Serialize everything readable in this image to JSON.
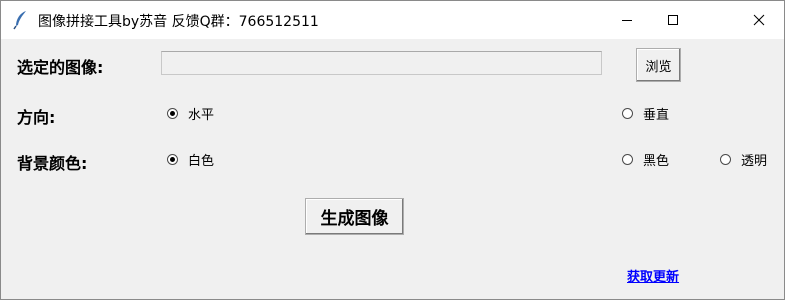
{
  "window": {
    "title": "图像拼接工具by苏音 反馈Q群：766512511",
    "icon": "feather-icon",
    "controls": [
      "minimize-icon",
      "maximize-icon",
      "close-icon"
    ]
  },
  "form": {
    "image_label": "选定的图像:",
    "image_path_value": "",
    "browse_label": "浏览",
    "direction_label": "方向:",
    "direction_options": [
      {
        "label": "水平",
        "checked": true
      },
      {
        "label": "垂直",
        "checked": false
      }
    ],
    "bg_label": "背景颜色:",
    "bg_options": [
      {
        "label": "白色",
        "checked": true
      },
      {
        "label": "黑色",
        "checked": false
      },
      {
        "label": "透明",
        "checked": false
      }
    ],
    "generate_label": "生成图像",
    "update_link": "获取更新"
  },
  "colors": {
    "background": "#f0f0f0",
    "titlebar": "#ffffff",
    "link": "#0000ff"
  }
}
